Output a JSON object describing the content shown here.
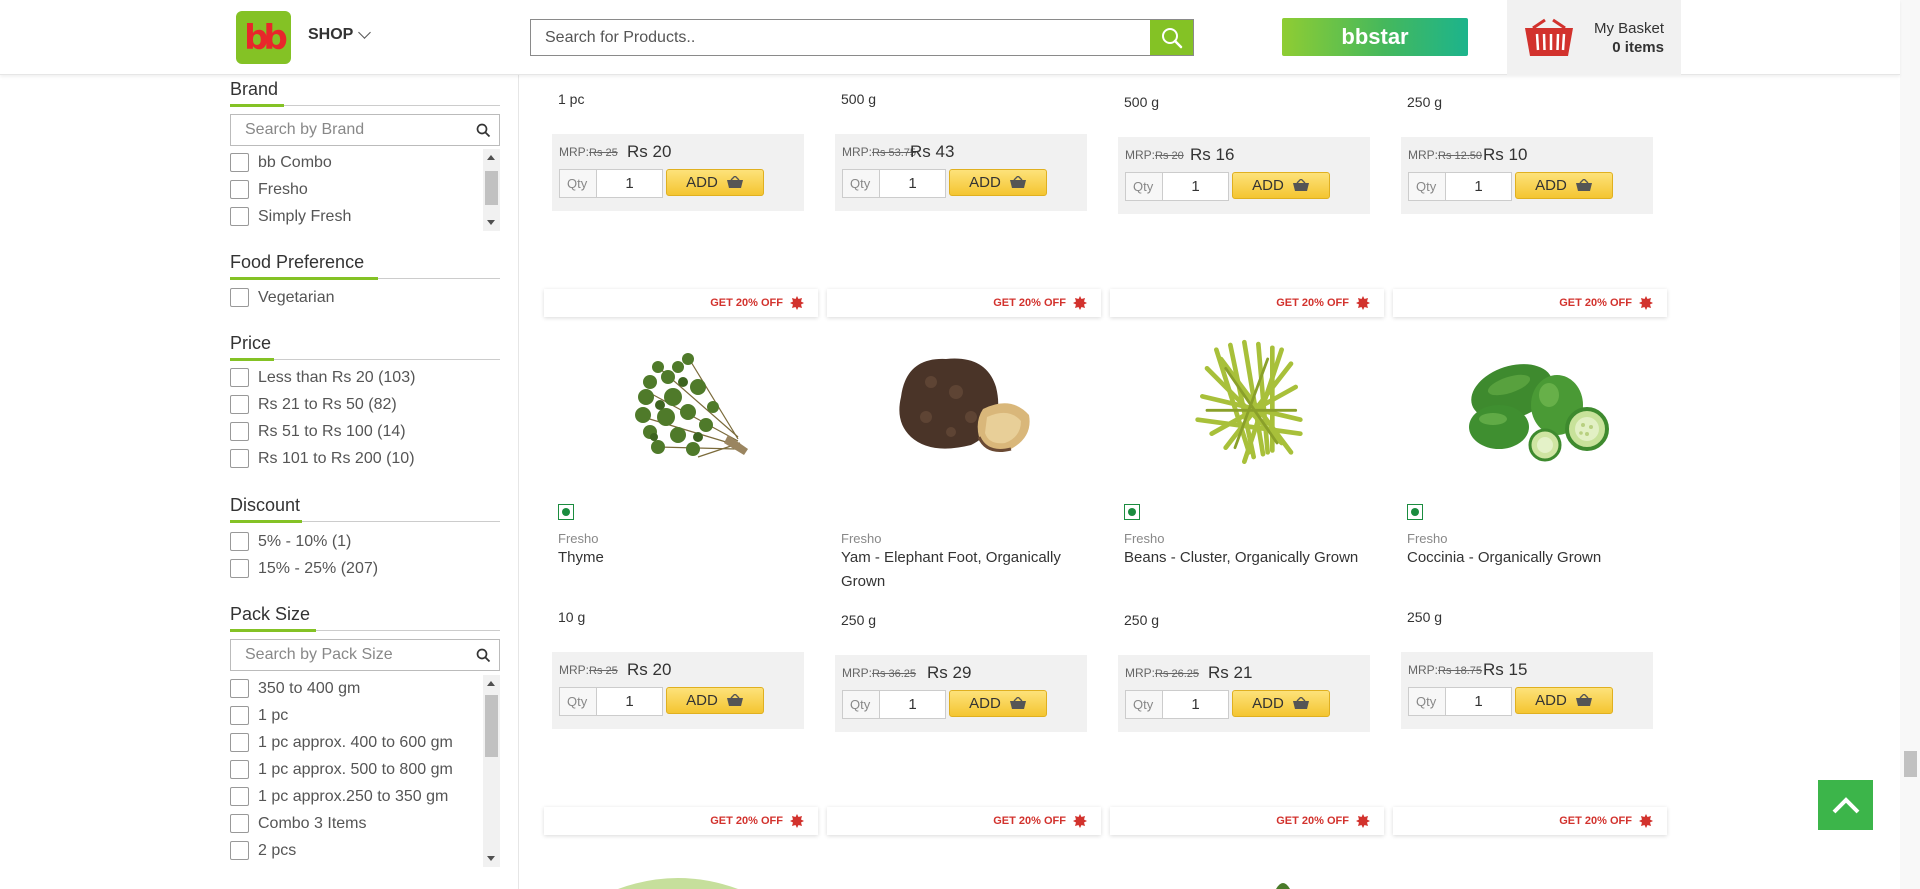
{
  "header": {
    "logo_text": "bb",
    "shop_label": "SHOP",
    "search_placeholder": "Search for Products..",
    "bbstar_label": "bbstar",
    "basket_title": "My Basket",
    "basket_count": "0 items"
  },
  "colors": {
    "brand_green": "#84c225",
    "offer_red": "#d2322d",
    "add_yellow": "#f4c531",
    "veg_green": "#1b8c3f"
  },
  "filters": {
    "brand": {
      "title": "Brand",
      "search_placeholder": "Search by Brand",
      "options": [
        "bb Combo",
        "Fresho",
        "Simply Fresh"
      ]
    },
    "food_preference": {
      "title": "Food Preference",
      "options": [
        "Vegetarian"
      ]
    },
    "price": {
      "title": "Price",
      "options": [
        "Less than Rs 20 (103)",
        "Rs 21 to Rs 50 (82)",
        "Rs 51 to Rs 100 (14)",
        "Rs 101 to Rs 200 (10)"
      ]
    },
    "discount": {
      "title": "Discount",
      "options": [
        "5% - 10% (1)",
        "15% - 25% (207)"
      ]
    },
    "pack_size": {
      "title": "Pack Size",
      "search_placeholder": "Search by Pack Size",
      "options": [
        "350 to 400 gm",
        "1 pc",
        "1 pc approx. 400 to 600 gm",
        "1 pc approx. 500 to 800 gm",
        "1 pc approx.250 to 350 gm",
        "Combo 3 Items",
        "2 pcs"
      ]
    }
  },
  "common": {
    "mrp_label": "MRP:",
    "qty_label": "Qty",
    "qty_value": "1",
    "add_label": "ADD",
    "offer_text": "GET 20% OFF"
  },
  "products_top": [
    {
      "size": "1 pc",
      "mrp": "Rs 25",
      "price": "Rs 20"
    },
    {
      "size": "500 g",
      "mrp": "Rs 53.75",
      "price": "Rs 43"
    },
    {
      "size": "500 g",
      "mrp": "Rs 20",
      "price": "Rs 16"
    },
    {
      "size": "250 g",
      "mrp": "Rs 12.50",
      "price": "Rs 10"
    }
  ],
  "products": [
    {
      "brand": "Fresho",
      "name": "Thyme",
      "size": "10 g",
      "mrp": "Rs 25",
      "price": "Rs 20",
      "image": "thyme-image"
    },
    {
      "brand": "Fresho",
      "name": "Yam - Elephant Foot, Organically Grown",
      "size": "250 g",
      "mrp": "Rs 36.25",
      "price": "Rs 29",
      "image": "yam-image"
    },
    {
      "brand": "Fresho",
      "name": "Beans - Cluster, Organically Grown",
      "size": "250 g",
      "mrp": "Rs 26.25",
      "price": "Rs 21",
      "image": "beans-image"
    },
    {
      "brand": "Fresho",
      "name": "Coccinia - Organically Grown",
      "size": "250 g",
      "mrp": "Rs 18.75",
      "price": "Rs 15",
      "image": "coccinia-image"
    }
  ]
}
